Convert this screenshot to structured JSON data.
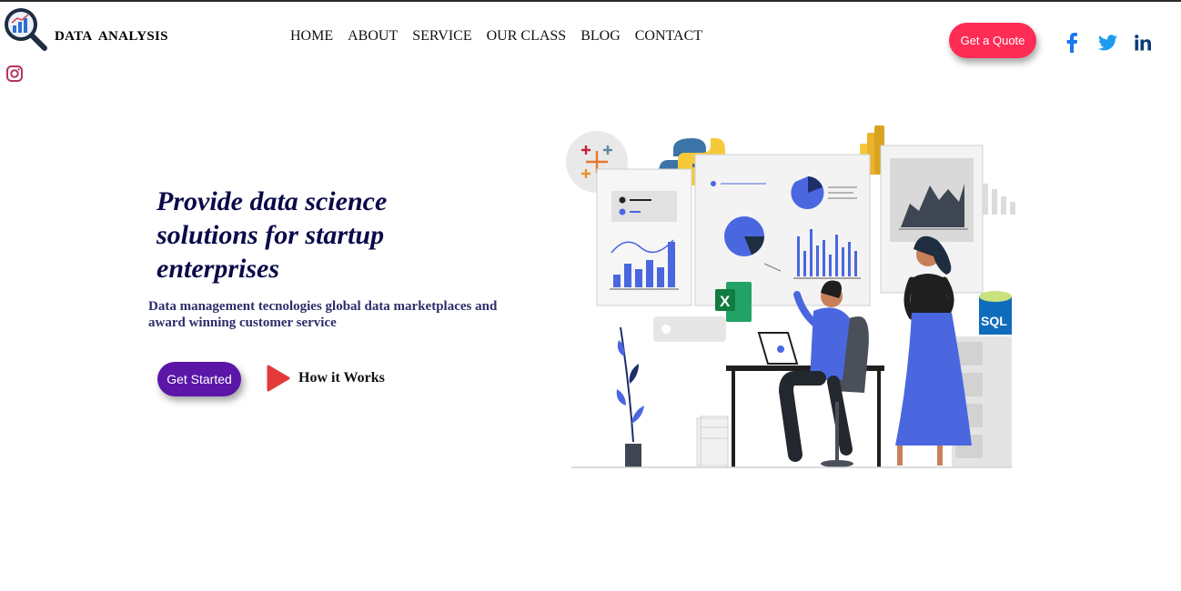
{
  "header": {
    "logo_text": "DATA  ANALYSIS",
    "nav": [
      "HOME",
      "ABOUT",
      "SERVICE",
      "OUR CLASS",
      "BLOG",
      "CONTACT"
    ],
    "quote_button": "Get a Quote",
    "social": [
      "facebook-icon",
      "twitter-icon",
      "linkedin-icon",
      "instagram-icon"
    ]
  },
  "hero": {
    "title": "Provide data science solutions for startup enterprises",
    "subtitle": "Data management tecnologies global data marketplaces and award winning customer service",
    "cta_primary": "Get Started",
    "cta_secondary": "How it Works"
  },
  "illustration": {
    "sql_label": "SQL",
    "excel_label": "X"
  },
  "colors": {
    "accent_red": "#ff2c55",
    "accent_purple": "#5b16a8",
    "title_navy": "#0a0a4a",
    "illustration_blue": "#4a67e0",
    "facebook": "#1877f2",
    "twitter": "#1d9bf0",
    "linkedin": "#0a3d7a"
  }
}
